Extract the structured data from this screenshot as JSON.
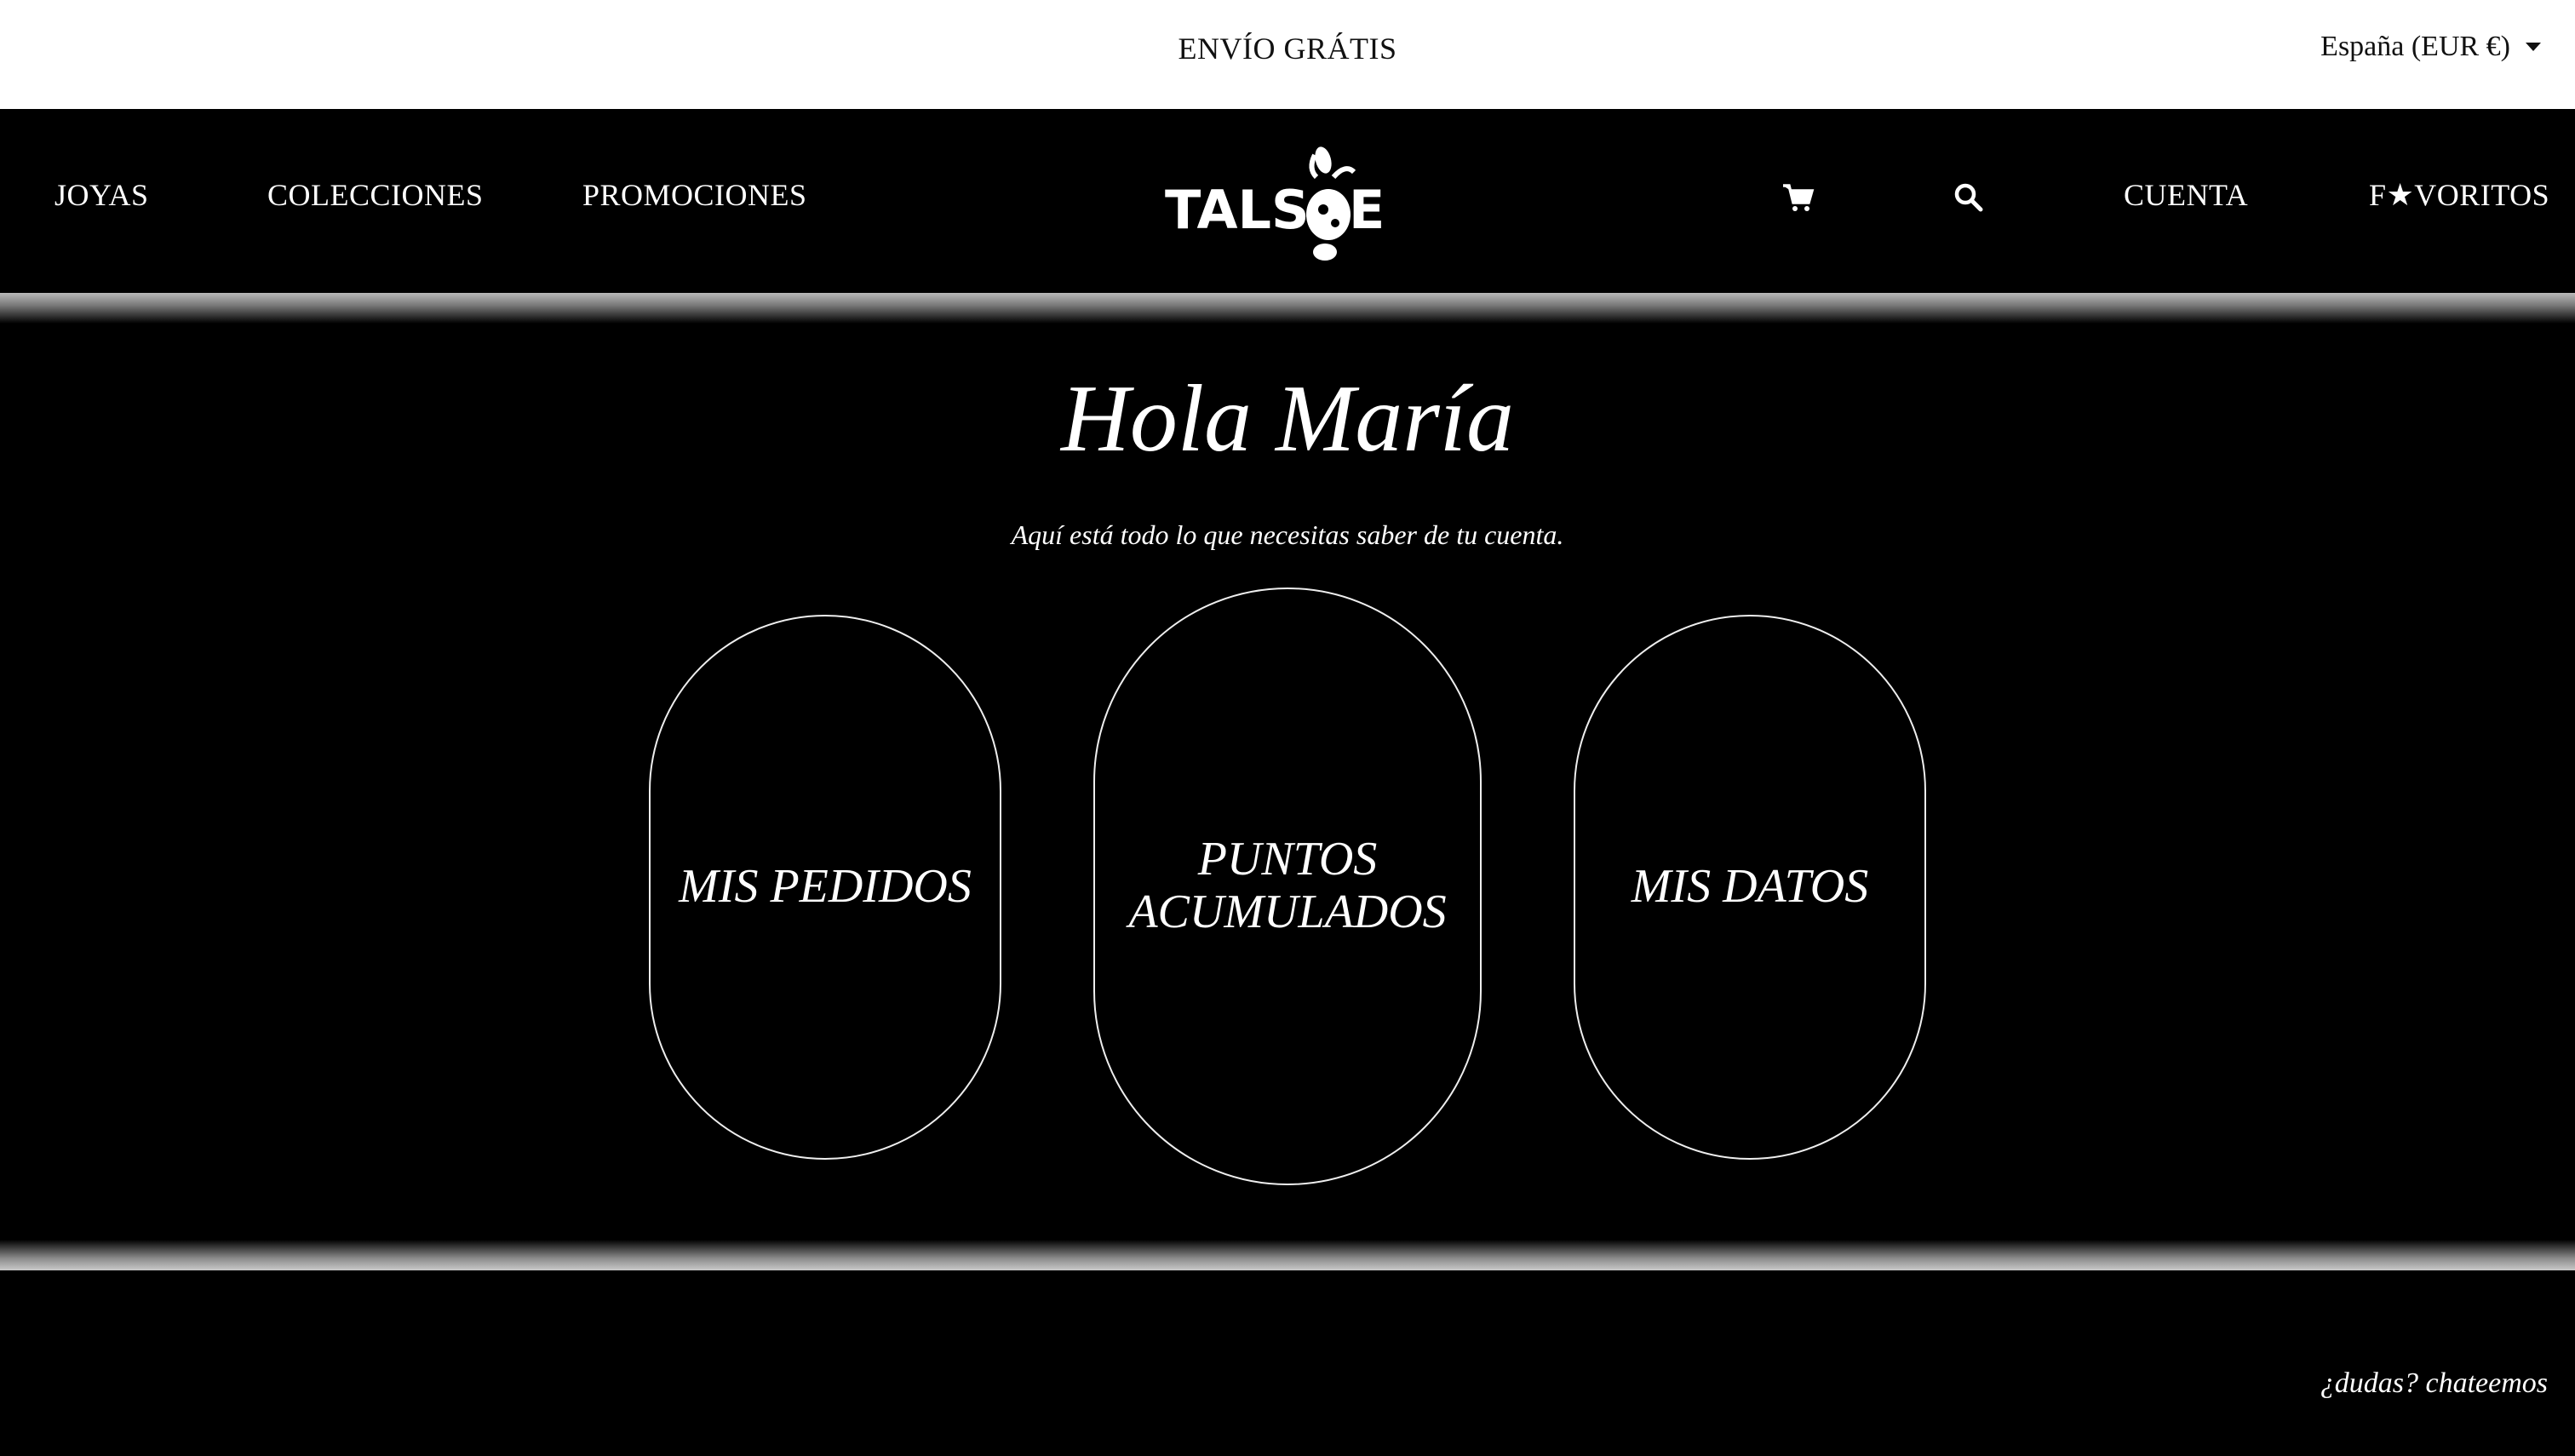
{
  "topbar": {
    "shipping": "ENVÍO GRÁTIS",
    "region": "España (EUR €)"
  },
  "nav": {
    "left": [
      "JOYAS",
      "COLECCIONES",
      "PROMOCIONES"
    ],
    "logo_text": "TALS E",
    "account": "CUENTA",
    "favorites": "F★VORITOS"
  },
  "main": {
    "greeting": "Hola María",
    "subtitle": "Aquí está todo lo que necesitas saber de tu cuenta.",
    "cards": [
      "MIS PEDIDOS",
      "PUNTOS\nACUMULADOS",
      "MIS DATOS"
    ]
  },
  "chat": "¿dudas? chateemos"
}
